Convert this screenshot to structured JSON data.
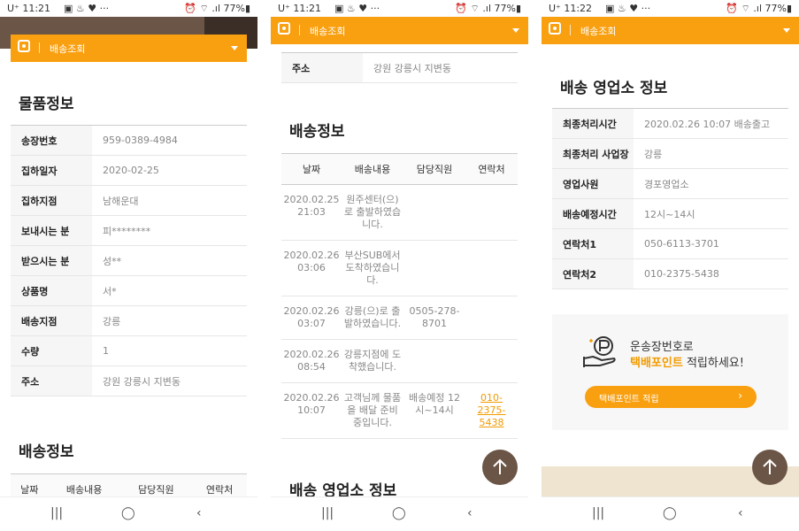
{
  "status_bars": [
    {
      "time": "U⁺ 11:21",
      "icons_left": "▣ ♨ ♥ ···",
      "right": "⏰ ⌔ .ıl 77%▮"
    },
    {
      "time": "U⁺ 11:21",
      "icons_left": "▣ ♨ ♥ ···",
      "right": "⏰ ⌔ .ıl 77%▮"
    },
    {
      "time": "U⁺ 11:22",
      "icons_left": "▣ ♨ ♥ ···",
      "right": "⏰ ⌔ .ıl 77%▮"
    }
  ],
  "header_title": "배송조회",
  "colors": {
    "accent": "#f9a011",
    "brown": "#6b5546",
    "link": "#f29b00"
  },
  "item_info": {
    "title": "물품정보",
    "rows": [
      {
        "k": "송장번호",
        "v": "959-0389-4984"
      },
      {
        "k": "집하일자",
        "v": "2020-02-25"
      },
      {
        "k": "집하지점",
        "v": "남해운대"
      },
      {
        "k": "보내시는 분",
        "v": "피********"
      },
      {
        "k": "받으시는 분",
        "v": "성**"
      },
      {
        "k": "상품명",
        "v": "서*"
      },
      {
        "k": "배송지점",
        "v": "강릉"
      },
      {
        "k": "수량",
        "v": "1"
      },
      {
        "k": "주소",
        "v": "강원 강릉시 지변동"
      }
    ]
  },
  "delivery_info": {
    "title": "배송정보",
    "headers": [
      "날짜",
      "배송내용",
      "담당직원",
      "연락처"
    ],
    "rows": [
      {
        "date": "2020.02.25 21:03",
        "content": "원주센터(으)로 출발하였습니다.",
        "staff": "",
        "contact": ""
      },
      {
        "date": "2020.02.26 03:06",
        "content": "부산SUB에서 도착하였습니다.",
        "staff": "",
        "contact": ""
      },
      {
        "date": "2020.02.26 03:07",
        "content": "강릉(으)로 출발하였습니다.",
        "staff": "0505-278-8701",
        "contact": ""
      },
      {
        "date": "2020.02.26 08:54",
        "content": "강릉지점에 도착했습니다.",
        "staff": "",
        "contact": ""
      },
      {
        "date": "2020.02.26 10:07",
        "content": "고객님께 물품을 배달 준비중입니다.",
        "staff": "배송예정 12시~14시",
        "contact": "010-2375-5438"
      }
    ]
  },
  "address_row": {
    "k": "주소",
    "v": "강원 강릉시 지변동"
  },
  "office_info": {
    "title": "배송 영업소 정보",
    "rows": [
      {
        "k": "최종처리시간",
        "v": "2020.02.26 10:07 배송출고"
      },
      {
        "k": "최종처리 사업장",
        "v": "강릉"
      },
      {
        "k": "영업사원",
        "v": "경포영업소"
      },
      {
        "k": "배송예정시간",
        "v": "12시~14시"
      },
      {
        "k": "연락처1",
        "v": "050-6113-3701"
      },
      {
        "k": "연락처2",
        "v": "010-2375-5438"
      }
    ]
  },
  "point": {
    "line1": "운송장번호로",
    "line2_highlight": "택배포인트",
    "line2_rest": " 적립하세요!",
    "button": "택배포인트 적립",
    "chevron": "›"
  },
  "nav": {
    "recent": "|||",
    "home": "◯",
    "back": "‹"
  }
}
